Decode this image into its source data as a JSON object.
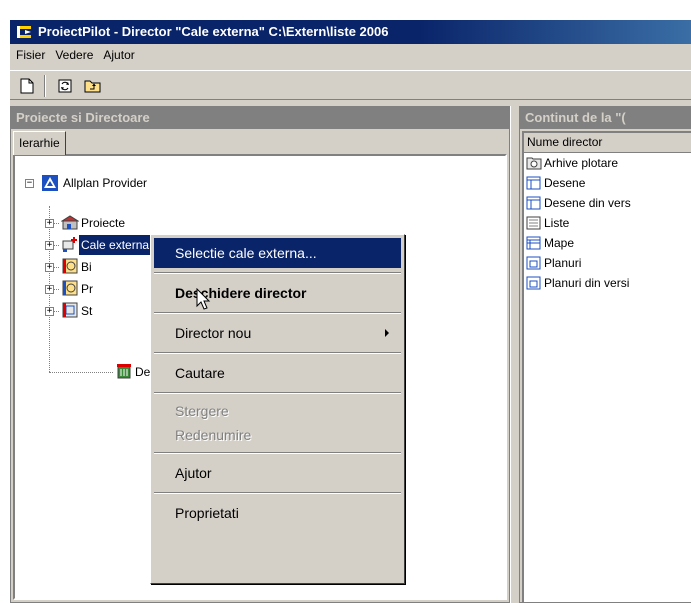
{
  "window": {
    "title": "ProiectPilot - Director \"Cale externa\" C:\\Extern\\liste 2006"
  },
  "menubar": [
    "Fisier",
    "Vedere",
    "Ajutor"
  ],
  "toolbar": {
    "buttons": [
      "new-document-icon",
      "refresh-icon",
      "folder-up-icon"
    ]
  },
  "left_pane": {
    "header": "Proiecte si Directoare",
    "tab": "Ierarhie",
    "tree": {
      "root": "Allplan Provider",
      "children": [
        "Proiecte",
        "Cale externa",
        "Bi",
        "Pr",
        "St",
        "De"
      ]
    }
  },
  "right_pane": {
    "header": "Continut de la \"(",
    "column_header": "Nume director",
    "items": [
      "Arhive plotare",
      "Desene",
      "Desene din vers",
      "Liste",
      "Mape",
      "Planuri",
      "Planuri din versi"
    ]
  },
  "context_menu": {
    "items": [
      "Selectie cale externa...",
      "Deschidere director",
      "Director nou",
      "Cautare",
      "Stergere",
      "Redenumire",
      "Ajutor",
      "Proprietati"
    ]
  },
  "colors": {
    "titlebar": "#0a246a",
    "highlight": "#0a246a",
    "face": "#d4d0c8",
    "pane_header": "#808080"
  }
}
